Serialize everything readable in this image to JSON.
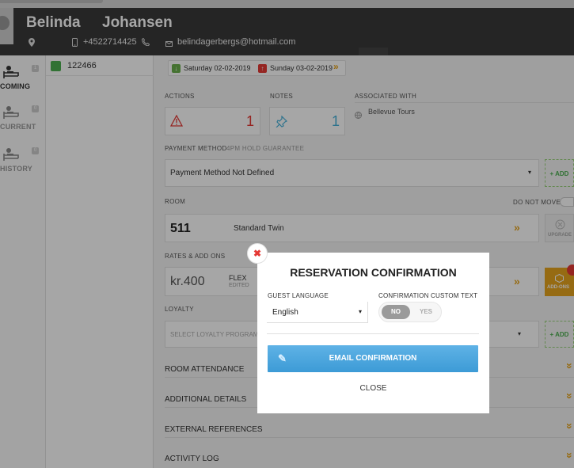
{
  "guest": {
    "first_name": "Belinda",
    "last_name": "Johansen",
    "phone": "+4522714425",
    "email": "belindagerbergs@hotmail.com"
  },
  "sidebar": {
    "items": [
      {
        "label": "COMING",
        "count": "1"
      },
      {
        "label": "CURRENT",
        "count": "0"
      },
      {
        "label": "HISTORY",
        "count": "0"
      }
    ]
  },
  "room_list": {
    "items": [
      {
        "number": "122466"
      }
    ]
  },
  "stay": {
    "arrival": "Saturday 02-02-2019",
    "departure": "Sunday 03-02-2019"
  },
  "sections": {
    "actions": {
      "label": "ACTIONS",
      "count": "1"
    },
    "notes": {
      "label": "NOTES",
      "count": "1"
    },
    "associated": {
      "label": "ASSOCIATED WITH",
      "value": "Bellevue Tours"
    },
    "payment": {
      "label": "PAYMENT METHOD",
      "sub": "4PM HOLD GUARANTEE",
      "value": "Payment Method Not Defined",
      "add": "+ ADD"
    },
    "room": {
      "label": "ROOM",
      "do_not_move": "DO NOT MOVE",
      "number": "511",
      "type": "Standard Twin",
      "upgrade": "UPGRADE"
    },
    "rates": {
      "label": "RATES & ADD ONS",
      "price": "kr.400",
      "rate_code": "FLEX",
      "rate_status": "EDITED",
      "addons": "ADD-ONS"
    },
    "loyalty": {
      "label": "LOYALTY",
      "placeholder": "SELECT LOYALTY PROGRAM",
      "add": "+ ADD"
    },
    "accordion": [
      "ROOM ATTENDANCE",
      "ADDITIONAL DETAILS",
      "EXTERNAL REFERENCES",
      "ACTIVITY LOG"
    ]
  },
  "modal": {
    "title": "RESERVATION CONFIRMATION",
    "guest_language_label": "GUEST LANGUAGE",
    "guest_language_value": "English",
    "custom_text_label": "CONFIRMATION CUSTOM TEXT",
    "toggle_no": "NO",
    "toggle_yes": "YES",
    "email_button": "EMAIL CONFIRMATION",
    "close": "CLOSE"
  },
  "colors": {
    "header": "#393939",
    "accent_blue": "#3d9bd6",
    "accent_orange": "#e7a51e",
    "accent_red": "#e53935",
    "accent_green": "#4caf50"
  }
}
